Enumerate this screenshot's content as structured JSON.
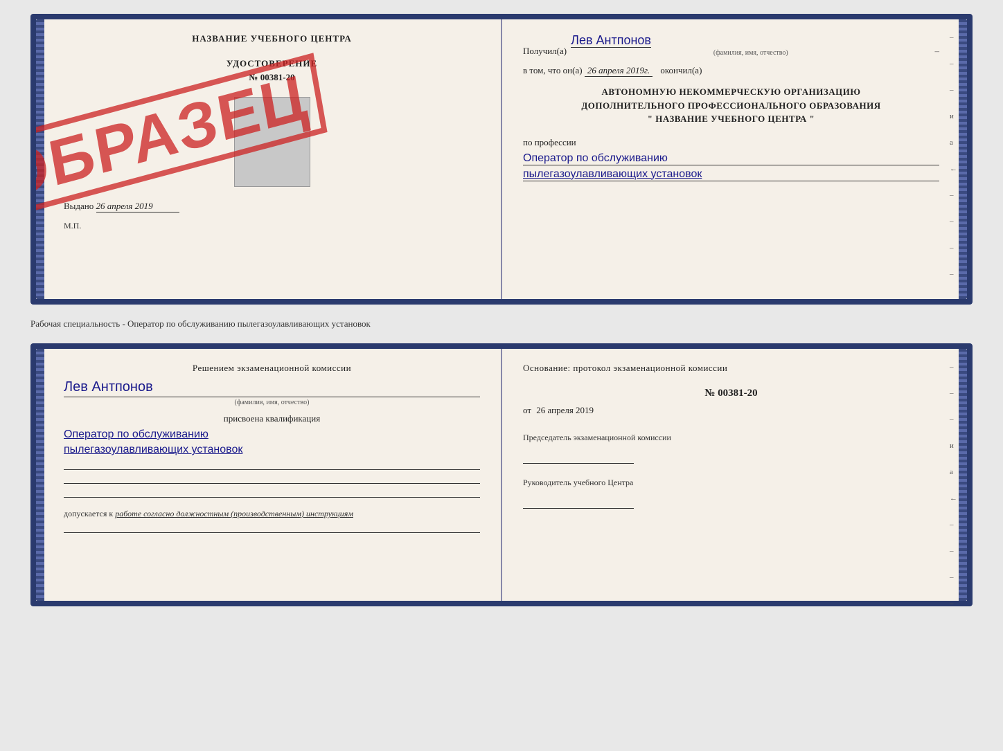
{
  "top_document": {
    "left_page": {
      "title": "НАЗВАНИЕ УЧЕБНОГО ЦЕНТРА",
      "cert_type": "УДОСТОВЕРЕНИЕ",
      "cert_number": "№ 00381-20",
      "stamp_text": "ОБРАЗЕЦ",
      "issued_label": "Выдано",
      "issued_date": "26 апреля 2019",
      "mp_label": "М.П."
    },
    "right_page": {
      "recipient_prefix": "Получил(а)",
      "recipient_name": "Лев Антпонов",
      "recipient_sublabel": "(фамилия, имя, отчество)",
      "date_prefix": "в том, что он(а)",
      "date_value": "26 апреля 2019г.",
      "date_suffix": "окончил(а)",
      "org_line1": "АВТОНОМНУЮ НЕКОММЕРЧЕСКУЮ ОРГАНИЗАЦИЮ",
      "org_line2": "ДОПОЛНИТЕЛЬНОГО ПРОФЕССИОНАЛЬНОГО ОБРАЗОВАНИЯ",
      "org_line3": "\" НАЗВАНИЕ УЧЕБНОГО ЦЕНТРА \"",
      "profession_prefix": "по профессии",
      "profession_line1": "Оператор по обслуживанию",
      "profession_line2": "пылегазоулавливающих установок",
      "side_dashes": [
        "–",
        "–",
        "–",
        "и",
        "а",
        "←",
        "–",
        "–",
        "–",
        "–"
      ]
    }
  },
  "separator": {
    "text": "Рабочая специальность - Оператор по обслуживанию пылегазоулавливающих установок"
  },
  "bottom_document": {
    "left_page": {
      "commission_text": "Решением экзаменационной комиссии",
      "person_name": "Лев Антпонов",
      "person_sublabel": "(фамилия, имя, отчество)",
      "qual_label": "присвоена квалификация",
      "qual_line1": "Оператор по обслуживанию",
      "qual_line2": "пылегазоулавливающих установок",
      "blank_lines": 3,
      "admission_prefix": "допускается к",
      "admission_text": "работе согласно должностным (производственным) инструкциям"
    },
    "right_page": {
      "basis_text": "Основание: протокол экзаменационной комиссии",
      "protocol_number": "№ 00381-20",
      "protocol_date_prefix": "от",
      "protocol_date": "26 апреля 2019",
      "chairman_title": "Председатель экзаменационной комиссии",
      "director_title": "Руководитель учебного Центра",
      "side_dashes": [
        "–",
        "–",
        "–",
        "и",
        "а",
        "←",
        "–",
        "–",
        "–",
        "–"
      ]
    }
  }
}
